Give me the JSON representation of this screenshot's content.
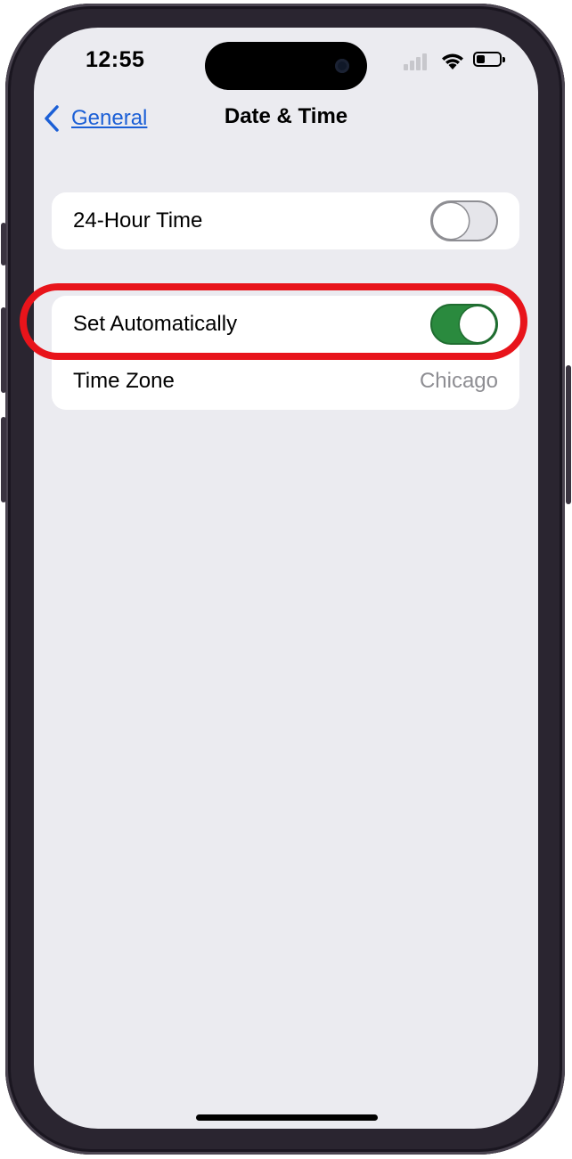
{
  "status_bar": {
    "time": "12:55",
    "signal_icon": "signal-bars-icon",
    "wifi_icon": "wifi-icon",
    "battery_icon": "battery-icon"
  },
  "nav": {
    "back_label": "General",
    "title": "Date & Time"
  },
  "settings": {
    "hour_24": {
      "label": "24-Hour Time",
      "enabled": false
    },
    "set_automatically": {
      "label": "Set Automatically",
      "enabled": true
    },
    "time_zone": {
      "label": "Time Zone",
      "value": "Chicago"
    }
  },
  "colors": {
    "accent_blue": "#1b5fd6",
    "toggle_on": "#2a8a3e",
    "highlight_red": "#e8141b",
    "background": "#ebebf0"
  }
}
